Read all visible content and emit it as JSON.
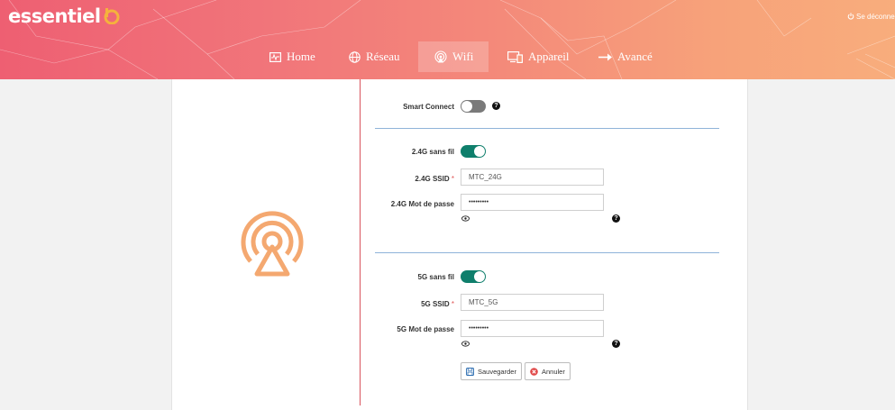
{
  "brand": {
    "name": "essentiel",
    "accent": "#f08a5d"
  },
  "header": {
    "logout_label": "Se déconnecter"
  },
  "nav": {
    "items": [
      {
        "label": "Home",
        "icon": "monitor-pulse-icon"
      },
      {
        "label": "Réseau",
        "icon": "globe-icon"
      },
      {
        "label": "Wifi",
        "icon": "wifi-icon",
        "active": true
      },
      {
        "label": "Appareil",
        "icon": "devices-icon"
      },
      {
        "label": "Avancé",
        "icon": "arrow-right-icon"
      }
    ]
  },
  "form": {
    "smart_connect": {
      "label": "Smart Connect",
      "on": false
    },
    "band24": {
      "wireless_label": "2.4G sans fil",
      "wireless_on": true,
      "ssid_label": "2.4G SSID",
      "ssid_value": "MTC_24G",
      "password_label": "2.4G Mot de passe",
      "password_value": "•••••••••"
    },
    "band5": {
      "wireless_label": "5G sans fil",
      "wireless_on": true,
      "ssid_label": "5G SSID",
      "ssid_value": "MTC_5G",
      "password_label": "5G Mot de passe",
      "password_value": "•••••••••"
    },
    "required_mark": "*",
    "help_mark": "?",
    "save_label": "Sauvegarder",
    "cancel_label": "Annuler"
  }
}
